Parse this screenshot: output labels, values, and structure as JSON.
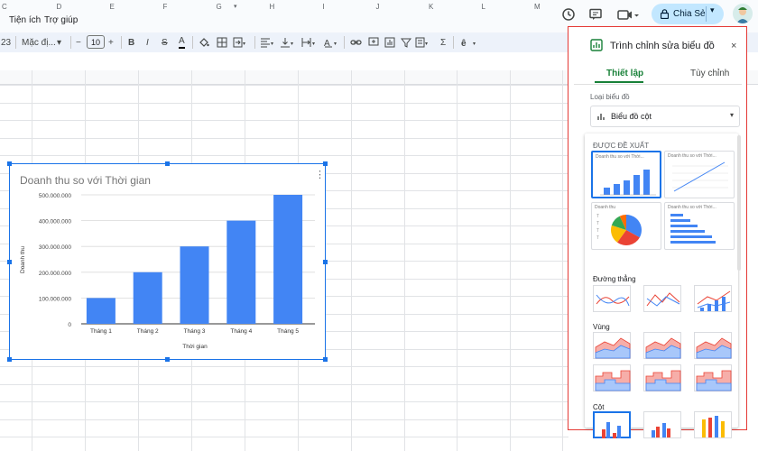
{
  "menu": {
    "items": [
      "Tiện ích",
      "Trợ giúp"
    ]
  },
  "topbar": {
    "share_label": "Chia Sẻ",
    "icons": [
      "history-icon",
      "comment-icon",
      "meet-icon",
      "lock-icon",
      "avatar"
    ]
  },
  "toolbar": {
    "zoom_partial": "23",
    "font_name": "Mặc đị...",
    "font_size": "10",
    "minus": "−",
    "plus": "+",
    "bold": "B",
    "italic": "I",
    "strike": "S",
    "text_color": "A",
    "sigma": "Σ"
  },
  "sheet": {
    "columns": [
      "C",
      "D",
      "E",
      "F",
      "G",
      "H",
      "I",
      "J",
      "K",
      "L",
      "M"
    ]
  },
  "chart": {
    "kebab": "⋮"
  },
  "chart_data": {
    "type": "bar",
    "title": "Doanh thu so với Thời gian",
    "categories": [
      "Tháng 1",
      "Tháng 2",
      "Tháng 3",
      "Tháng 4",
      "Tháng 5"
    ],
    "values": [
      100000000,
      200000000,
      300000000,
      400000000,
      500000000
    ],
    "xlabel": "Thời gian",
    "ylabel": "Doanh thu",
    "ylim": [
      0,
      500000000
    ],
    "yticks": [
      "0",
      "100.000.000",
      "200.000.000",
      "300.000.000",
      "400.000.000",
      "500.000.000"
    ],
    "bar_color": "#4285f4",
    "grid": true,
    "legend": "none"
  },
  "panel": {
    "title": "Trình chỉnh sửa biểu đồ",
    "close": "×",
    "tabs": [
      "Thiết lập",
      "Tùy chỉnh"
    ],
    "chart_type_label": "Loại biểu đồ",
    "chart_type_value": "Biểu đồ cột",
    "suggested_label": "ĐƯỢC ĐỀ XUẤT",
    "suggestions": [
      {
        "title": "Doanh thu so với Thời...",
        "kind": "column"
      },
      {
        "title": "Doanh thu so với Thời...",
        "kind": "line"
      },
      {
        "title": "Doanh thu",
        "kind": "pie"
      },
      {
        "title": "Doanh thu so với Thời...",
        "kind": "bar"
      }
    ],
    "line_label": "Đường thẳng",
    "area_label": "Vùng",
    "column_label": "Cột",
    "accent": "#1a73e8",
    "tab_active_color": "#188038"
  }
}
